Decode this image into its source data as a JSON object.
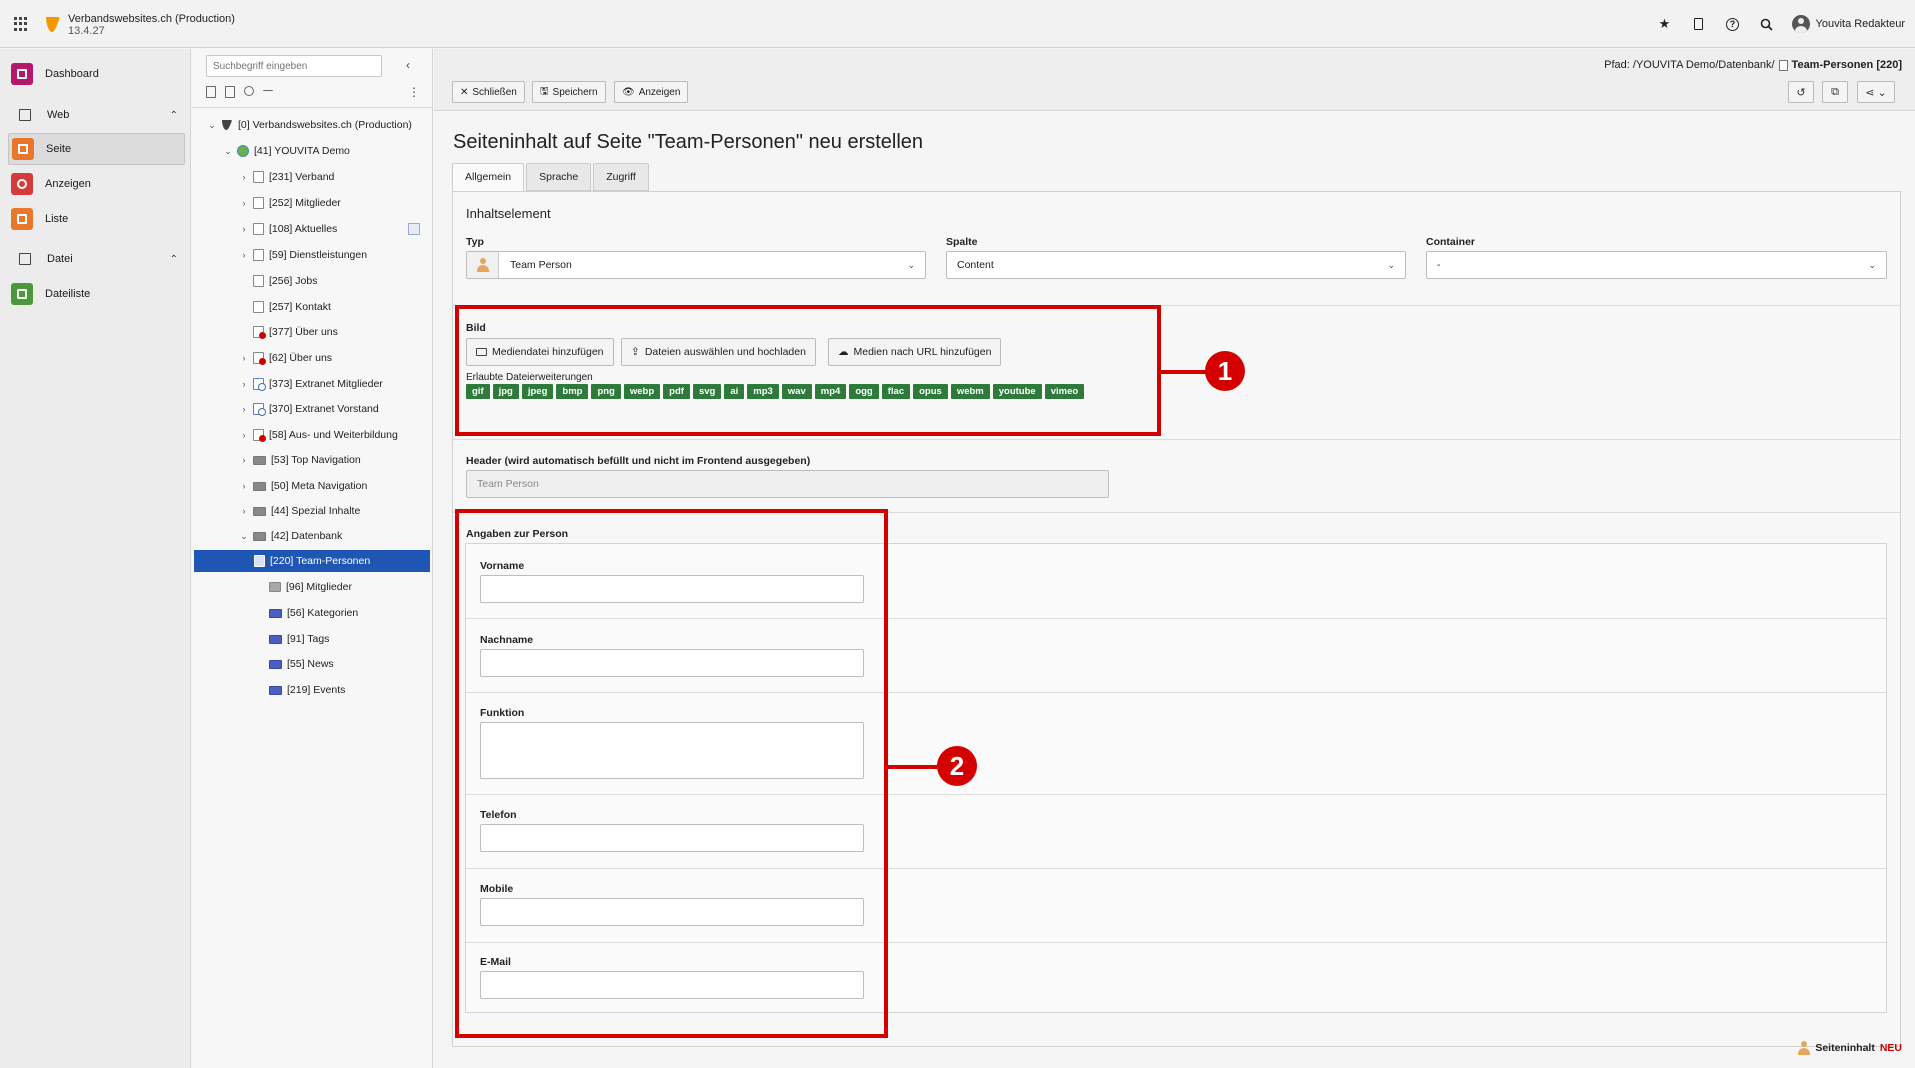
{
  "topbar": {
    "site_name": "Verbandswebsites.ch (Production)",
    "version": "13.4.27",
    "user": "Youvita Redakteur",
    "icons": [
      "star-icon",
      "bookmark-icon",
      "help-icon",
      "search-icon"
    ]
  },
  "modules": {
    "dashboard": "Dashboard",
    "web": "Web",
    "seite": "Seite",
    "anzeigen": "Anzeigen",
    "liste": "Liste",
    "datei": "Datei",
    "dateiliste": "Dateiliste",
    "colors": {
      "dashboard": "#b5176b",
      "seite": "#e8762b",
      "anzeigen": "#d43c3c",
      "liste": "#e8762b",
      "dateiliste": "#4a9a3c"
    }
  },
  "tree": {
    "search_placeholder": "Suchbegriff eingeben",
    "nodes": [
      "[0] Verbandswebsites.ch (Production)",
      "[41] YOUVITA Demo",
      "[231] Verband",
      "[252] Mitglieder",
      "[108] Aktuelles",
      "[59] Dienstleistungen",
      "[256] Jobs",
      "[257] Kontakt",
      "[377] Über uns",
      "[62] Über uns",
      "[373] Extranet Mitglieder",
      "[370] Extranet Vorstand",
      "[58] Aus- und Weiterbildung",
      "[53] Top Navigation",
      "[50] Meta Navigation",
      "[44] Spezial Inhalte",
      "[42] Datenbank",
      "[220] Team-Personen",
      "[96] Mitglieder",
      "[56] Kategorien",
      "[91] Tags",
      "[55] News",
      "[219] Events"
    ]
  },
  "docheader": {
    "path_label": "Pfad: /YOUVITA Demo/Datenbank/",
    "path_page": "Team-Personen [220]",
    "close": "Schließen",
    "save": "Speichern",
    "view": "Anzeigen"
  },
  "form": {
    "title": "Seiteninhalt auf Seite \"Team-Personen\" neu erstellen",
    "tabs": [
      "Allgemein",
      "Sprache",
      "Zugriff"
    ],
    "section": "Inhaltselement",
    "typ_label": "Typ",
    "typ_value": "Team Person",
    "spalte_label": "Spalte",
    "spalte_value": "Content",
    "container_label": "Container",
    "container_value": "-",
    "bild_label": "Bild",
    "media_add": "Mediendatei hinzufügen",
    "media_upload": "Dateien auswählen und hochladen",
    "media_url": "Medien nach URL hinzufügen",
    "ext_label": "Erlaubte Dateierweiterungen",
    "extensions": [
      "gif",
      "jpg",
      "jpeg",
      "bmp",
      "png",
      "webp",
      "pdf",
      "svg",
      "ai",
      "mp3",
      "wav",
      "mp4",
      "ogg",
      "flac",
      "opus",
      "webm",
      "youtube",
      "vimeo"
    ],
    "header_label": "Header (wird automatisch befüllt und nicht im Frontend ausgegeben)",
    "header_value": "Team Person",
    "person_section": "Angaben zur Person",
    "vorname": "Vorname",
    "nachname": "Nachname",
    "funktion": "Funktion",
    "telefon": "Telefon",
    "mobile": "Mobile",
    "email": "E-Mail"
  },
  "annotations": {
    "one": "1",
    "two": "2",
    "color": "#d40000"
  },
  "footer": {
    "label": "Seiteninhalt",
    "neu": "NEU"
  }
}
